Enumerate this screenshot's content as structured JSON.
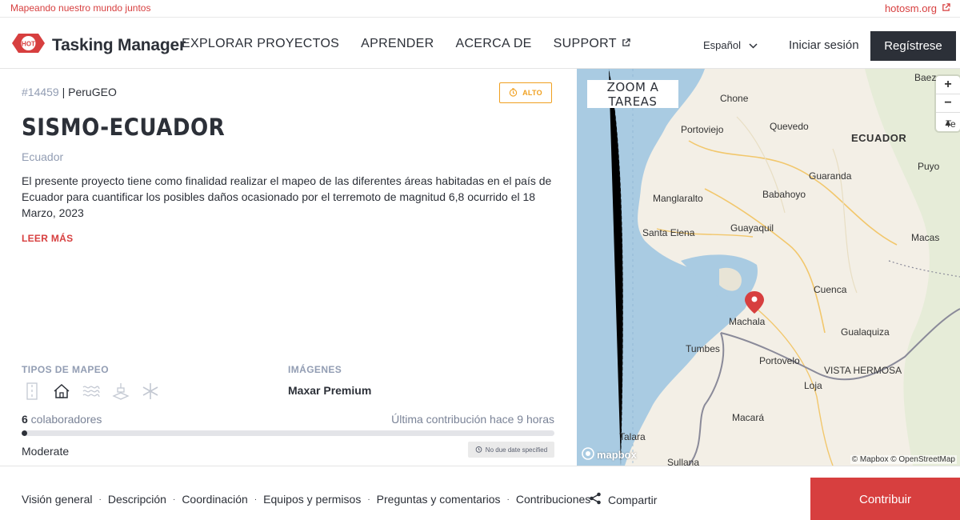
{
  "topbar": {
    "tagline": "Mapeando nuestro mundo juntos",
    "site_link": "hotosm.org"
  },
  "header": {
    "logo_badge": "HOT",
    "logo_text": "Tasking Manager",
    "nav": [
      {
        "label": "EXPLORAR PROYECTOS"
      },
      {
        "label": "APRENDER"
      },
      {
        "label": "ACERCA DE"
      },
      {
        "label": "SUPPORT"
      }
    ],
    "language": "Español",
    "login": "Iniciar sesión",
    "register": "Regístrese"
  },
  "project": {
    "id": "#14459",
    "organization": "PeruGEO",
    "priority": "ALTO",
    "title": "SISMO-ECUADOR",
    "country": "Ecuador",
    "description": "El presente proyecto tiene como finalidad realizar el mapeo de las diferentes áreas habitadas en el país de Ecuador para cuantificar los posibles daños ocasionado por el terremoto de magnitud 6,8 ocurrido el 18 Marzo, 2023",
    "read_more": "LEER MÁS",
    "mapping_types_label": "TIPOS DE MAPEO",
    "mapping_types": [
      "roads-icon",
      "buildings-icon",
      "waterways-icon",
      "landuse-icon",
      "other-icon"
    ],
    "imagery_label": "IMÁGENES",
    "imagery_value": "Maxar Premium",
    "contributors_count": "6",
    "contributors_label": " colaboradores",
    "last_contribution": "Última contribución hace 9 horas",
    "progress_percent": 1,
    "difficulty": "Moderate",
    "due_date": "No due date specified"
  },
  "map": {
    "zoom_button": "ZOOM A TAREAS",
    "zoom_in": "+",
    "zoom_out": "−",
    "reset": "▲",
    "attribution": "© Mapbox © OpenStreetMap",
    "mapbox_logo": "mapbox",
    "labels": [
      "Baez",
      "Chone",
      "Portoviejo",
      "Quevedo",
      "Te",
      "ECUADOR",
      "Guaranda",
      "Puyo",
      "Manglaralto",
      "Babahoyo",
      "Santa Elena",
      "Guayaquil",
      "Macas",
      "Cuenca",
      "Machala",
      "Gualaquiza",
      "Tumbes",
      "Portovelo",
      "VISTA HERMOSA",
      "Loja",
      "Macará",
      "Talara",
      "Sullana"
    ]
  },
  "bottom": {
    "tabs": [
      "Visión general",
      "Descripción",
      "Coordinación",
      "Equipos y permisos",
      "Preguntas y comentarios",
      "Contribuciones"
    ],
    "share": "Compartir",
    "contribute": "Contribuir"
  }
}
